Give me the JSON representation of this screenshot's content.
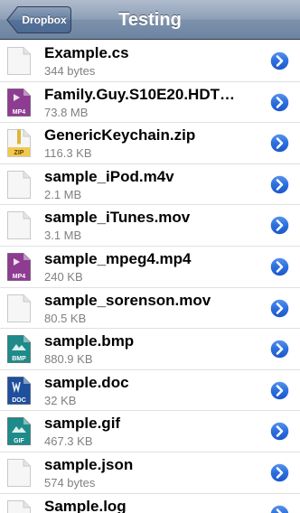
{
  "navbar": {
    "back_label": "Dropbox",
    "title": "Testing"
  },
  "files": [
    {
      "name": "Example.cs",
      "size": "344 bytes",
      "icon": "document-icon",
      "badge": "",
      "color": "#ffffff"
    },
    {
      "name": "Family.Guy.S10E20.HDT…",
      "size": "73.8 MB",
      "icon": "video-icon",
      "badge": "MP4",
      "color": "#8e3c92"
    },
    {
      "name": "GenericKeychain.zip",
      "size": "116.3 KB",
      "icon": "zip-icon",
      "badge": "ZIP",
      "color": "#f2c94c"
    },
    {
      "name": "sample_iPod.m4v",
      "size": "2.1 MB",
      "icon": "document-icon",
      "badge": "",
      "color": "#ffffff"
    },
    {
      "name": "sample_iTunes.mov",
      "size": "3.1 MB",
      "icon": "document-icon",
      "badge": "",
      "color": "#ffffff"
    },
    {
      "name": "sample_mpeg4.mp4",
      "size": "240 KB",
      "icon": "video-icon",
      "badge": "MP4",
      "color": "#8e3c92"
    },
    {
      "name": "sample_sorenson.mov",
      "size": "80.5 KB",
      "icon": "document-icon",
      "badge": "",
      "color": "#ffffff"
    },
    {
      "name": "sample.bmp",
      "size": "880.9 KB",
      "icon": "image-icon",
      "badge": "BMP",
      "color": "#1f8a8a"
    },
    {
      "name": "sample.doc",
      "size": "32 KB",
      "icon": "word-doc-icon",
      "badge": "DOC",
      "color": "#1e4f9c"
    },
    {
      "name": "sample.gif",
      "size": "467.3 KB",
      "icon": "image-icon",
      "badge": "GIF",
      "color": "#1f8a8a"
    },
    {
      "name": "sample.json",
      "size": "574 bytes",
      "icon": "document-icon",
      "badge": "",
      "color": "#ffffff"
    },
    {
      "name": "Sample.log",
      "size": "",
      "icon": "document-icon",
      "badge": "",
      "color": "#ffffff"
    }
  ]
}
